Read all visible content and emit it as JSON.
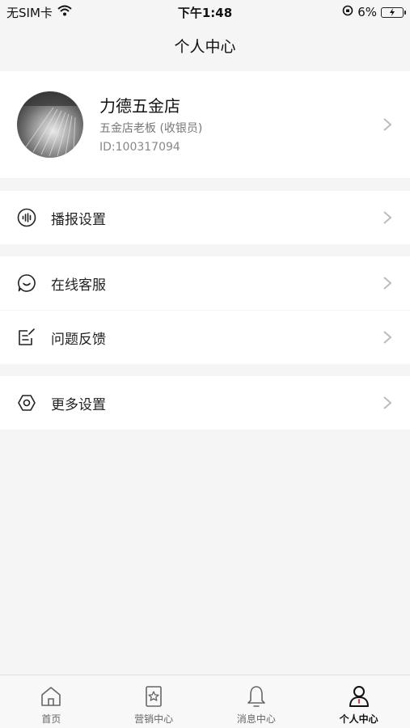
{
  "status": {
    "carrier": "无SIM卡",
    "time": "下午1:48",
    "battery": "6%"
  },
  "nav": {
    "title": "个人中心"
  },
  "profile": {
    "name": "力德五金店",
    "role": "五金店老板 (收银员)",
    "id": "ID:100317094"
  },
  "menu": {
    "broadcast": "播报设置",
    "online_service": "在线客服",
    "feedback": "问题反馈",
    "more_settings": "更多设置"
  },
  "tabs": [
    {
      "label": "首页",
      "icon": "home-icon",
      "active": false
    },
    {
      "label": "营销中心",
      "icon": "marketing-icon",
      "active": false
    },
    {
      "label": "消息中心",
      "icon": "bell-icon",
      "active": false
    },
    {
      "label": "个人中心",
      "icon": "user-icon",
      "active": true
    }
  ],
  "colors": {
    "background": "#f5f5f5",
    "card": "#ffffff",
    "text": "#222222",
    "muted": "#888888"
  }
}
